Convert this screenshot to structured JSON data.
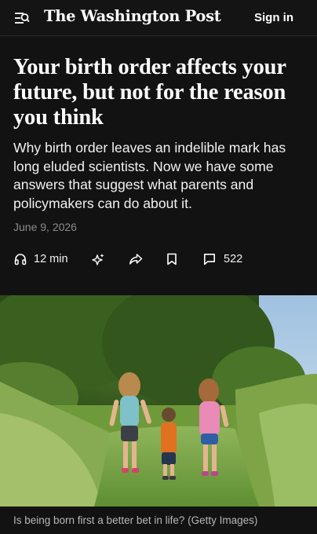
{
  "header": {
    "logo_text": "The Washington Post",
    "signin_label": "Sign in",
    "menu_icon": "menu-search-icon"
  },
  "article": {
    "headline": "Your birth order affects your future, but not for the reason you think",
    "dek": "Why birth order leaves an indelible mark has long eluded scientists. Now we have some answers that suggest what parents and policymakers can do about it.",
    "date": "June 9, 2026"
  },
  "actions": {
    "listen_label": "12 min",
    "listen_icon": "headphones-icon",
    "ai_icon": "sparkle-icon",
    "share_icon": "share-icon",
    "save_icon": "bookmark-icon",
    "comments_icon": "comment-icon",
    "comments_count": "522"
  },
  "image": {
    "caption": "Is being born first a better bet in life? (Getty Images)"
  },
  "colors": {
    "background": "#121212",
    "text": "#ffffff",
    "muted": "#8c8c8c"
  }
}
